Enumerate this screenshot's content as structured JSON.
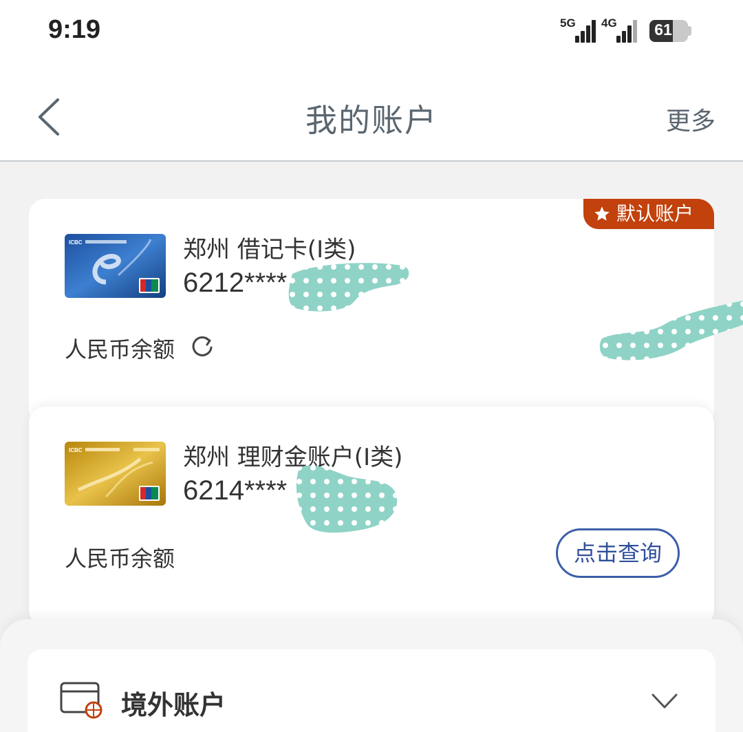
{
  "status_bar": {
    "time": "9:19",
    "network1": "5G",
    "network2": "4G",
    "battery": "61",
    "battery_level": 0.61
  },
  "header": {
    "title": "我的账户",
    "more": "更多"
  },
  "accounts": [
    {
      "badge": "默认账户",
      "name": "郑州 借记卡(I类)",
      "number": "6212****",
      "balance_label": "人民币余额",
      "card_color": "#2f6bb8"
    },
    {
      "name": "郑州 理财金账户(I类)",
      "number": "6214****",
      "balance_label": "人民币余额",
      "query_button": "点击查询",
      "card_color": "#d4a531"
    }
  ],
  "overseas": {
    "title": "境外账户"
  },
  "colors": {
    "badge": "#c2410c",
    "link": "#2f4f9a",
    "mask": "#8fd3c6"
  },
  "icons": [
    "back-arrow-icon",
    "star-icon",
    "refresh-icon",
    "card-globe-icon",
    "chevron-down-icon"
  ]
}
